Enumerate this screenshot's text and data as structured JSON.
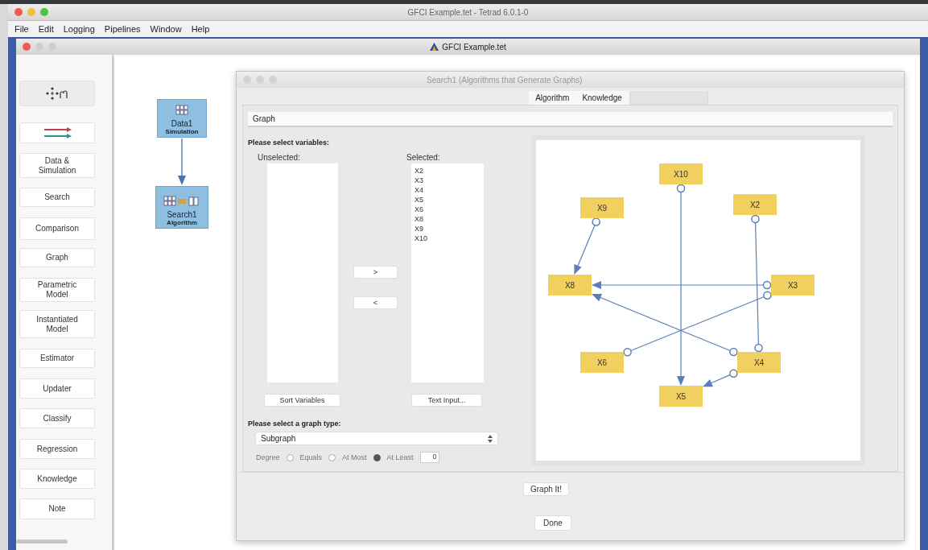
{
  "app": {
    "title": "GFCI Example.tet - Tetrad 6.0.1-0",
    "menu": [
      "File",
      "Edit",
      "Logging",
      "Pipelines",
      "Window",
      "Help"
    ]
  },
  "document_window": {
    "title": "GFCI Example.tet"
  },
  "palette": [
    {
      "kind": "select-tool"
    },
    {
      "kind": "edge-tool"
    },
    {
      "kind": "text",
      "label": "Data &\nSimulation"
    },
    {
      "kind": "text",
      "label": "Search"
    },
    {
      "kind": "text",
      "label": "Comparison"
    },
    {
      "kind": "text",
      "label": "Graph"
    },
    {
      "kind": "text",
      "label": "Parametric\nModel"
    },
    {
      "kind": "text",
      "label": "Instantiated\nModel"
    },
    {
      "kind": "text",
      "label": "Estimator"
    },
    {
      "kind": "text",
      "label": "Updater"
    },
    {
      "kind": "text",
      "label": "Classify"
    },
    {
      "kind": "text",
      "label": "Regression"
    },
    {
      "kind": "text",
      "label": "Knowledge"
    },
    {
      "kind": "text",
      "label": "Note"
    }
  ],
  "canvas_nodes": [
    {
      "name": "Data1",
      "type": "Simulation"
    },
    {
      "name": "Search1",
      "type": "Algorithm"
    }
  ],
  "dialog": {
    "title": "Search1 (Algorithms that Generate Graphs)",
    "tabs": [
      {
        "label": "Algorithm",
        "selected": false
      },
      {
        "label": "Knowledge",
        "selected": false
      }
    ],
    "subtab": "Graph",
    "variables_heading": "Please select variables:",
    "unselected_label": "Unselected:",
    "selected_label": "Selected:",
    "selected_variables": [
      "X2",
      "X3",
      "X4",
      "X5",
      "X6",
      "X8",
      "X9",
      "X10"
    ],
    "add_button": ">",
    "remove_button": "<",
    "sort_button": "Sort Variables",
    "text_input_button": "Text Input...",
    "graph_type_heading": "Please select a graph type:",
    "graph_type": "Subgraph",
    "degree": {
      "label": "Degree",
      "disabled": true,
      "value": "0",
      "options": [
        {
          "label": "Equals",
          "selected": false
        },
        {
          "label": "At Most",
          "selected": false
        },
        {
          "label": "At Least",
          "selected": true
        }
      ]
    },
    "graph": {
      "nodes": [
        "X10",
        "X9",
        "X2",
        "X8",
        "X3",
        "X6",
        "X4",
        "X5"
      ],
      "edges": [
        {
          "kind": "circle-arrow"
        },
        {
          "kind": "circle-arrow"
        },
        {
          "kind": "circle-circle"
        },
        {
          "kind": "circle-arrow"
        },
        {
          "kind": "circle-circle"
        },
        {
          "kind": "circle-arrow"
        },
        {
          "kind": "circle-arrow"
        }
      ]
    },
    "graph_button": "Graph It!",
    "done_button": "Done"
  }
}
